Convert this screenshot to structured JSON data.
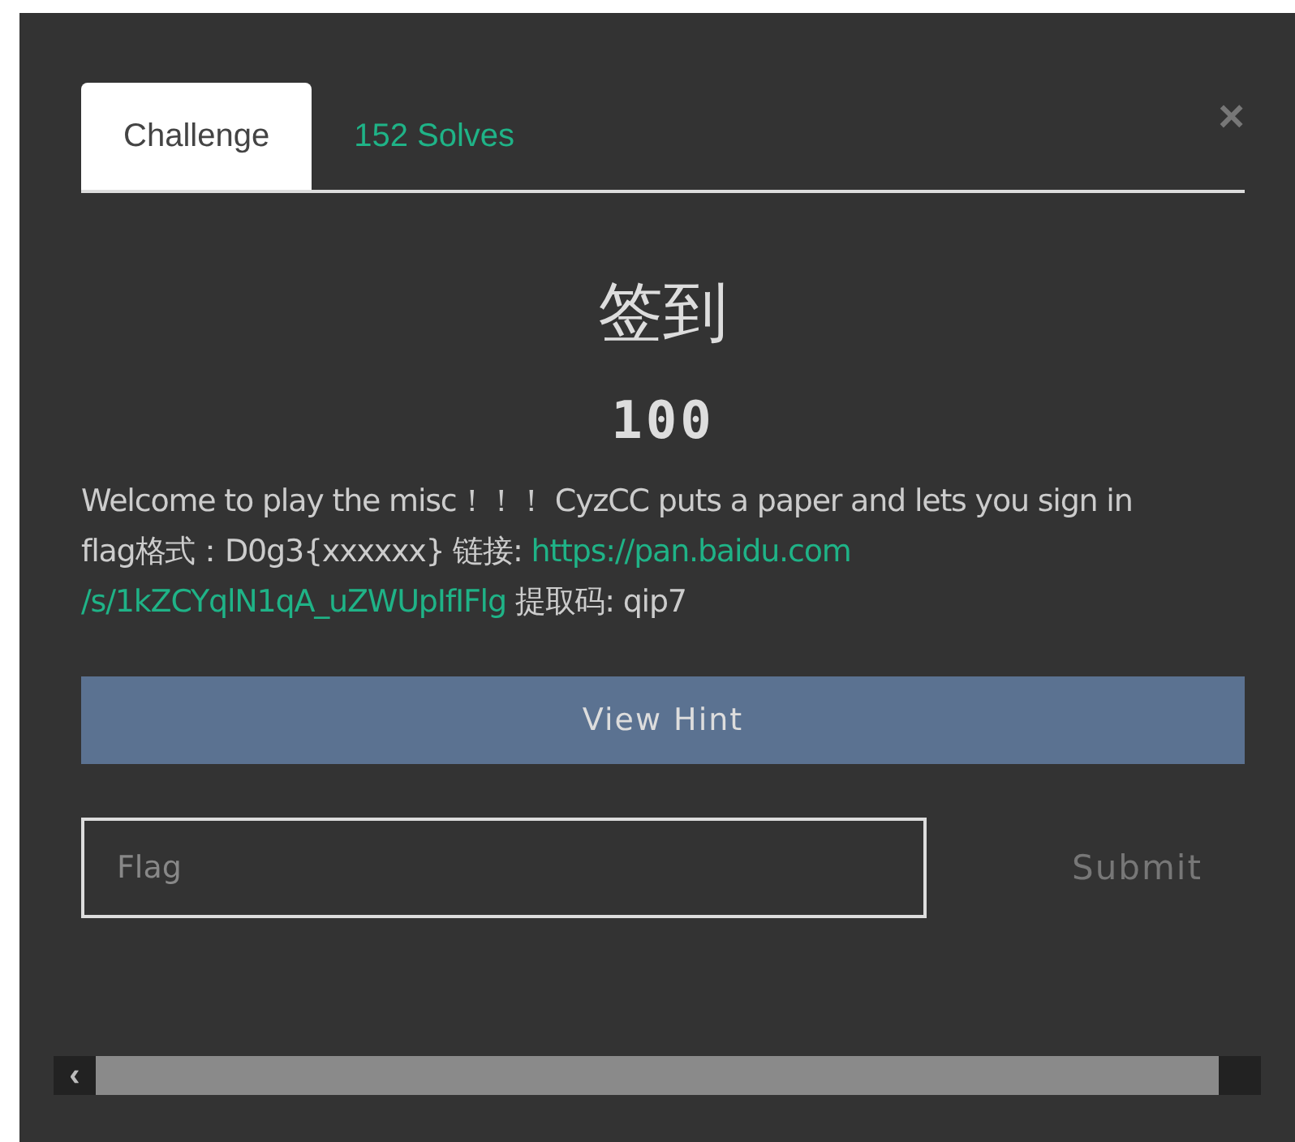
{
  "tabs": [
    {
      "label": "Challenge",
      "selected": true
    },
    {
      "label": "152 Solves",
      "selected": false
    }
  ],
  "close": "×",
  "challenge": {
    "name": "签到",
    "value": "100",
    "description_lines": [
      [
        {
          "kind": "text",
          "text": "Welcome to play the misc！！！ CyzCC puts a paper and lets you sign in"
        }
      ],
      [
        {
          "kind": "text",
          "text": "flag格式：D0g3{xxxxxx} 链接: "
        },
        {
          "kind": "link",
          "text": "https://pan.baidu.com"
        }
      ],
      [
        {
          "kind": "link",
          "text": "/s/1kZCYqlN1qA_uZWUpIfIFlg"
        },
        {
          "kind": "text",
          "text": " 提取码: qip7"
        }
      ]
    ]
  },
  "hint_button": "View Hint",
  "flag_field": {
    "placeholder": "Flag"
  },
  "submit_button": "Submit",
  "scrollbar_arrow": "‹"
}
